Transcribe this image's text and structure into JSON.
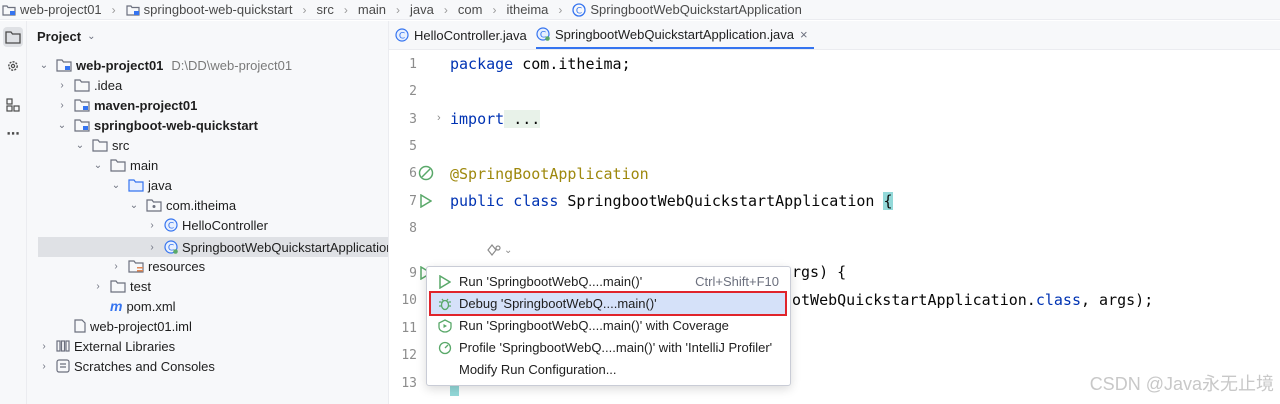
{
  "breadcrumb": [
    "web-project01",
    "springboot-web-quickstart",
    "src",
    "main",
    "java",
    "com",
    "itheima",
    "SpringbootWebQuickstartApplication"
  ],
  "project": {
    "title": "Project",
    "tree": [
      {
        "label": "web-project01",
        "path": "D:\\DD\\web-project01"
      },
      {
        "label": ".idea"
      },
      {
        "label": "maven-project01"
      },
      {
        "label": "springboot-web-quickstart"
      },
      {
        "label": "src"
      },
      {
        "label": "main"
      },
      {
        "label": "java"
      },
      {
        "label": "com.itheima"
      },
      {
        "label": "HelloController"
      },
      {
        "label": "SpringbootWebQuickstartApplication"
      },
      {
        "label": "resources"
      },
      {
        "label": "test"
      },
      {
        "label": "pom.xml"
      },
      {
        "label": "web-project01.iml"
      },
      {
        "label": "External Libraries"
      },
      {
        "label": "Scratches and Consoles"
      }
    ]
  },
  "tabs": [
    {
      "label": "HelloController.java"
    },
    {
      "label": "SpringbootWebQuickstartApplication.java",
      "close": "×"
    }
  ],
  "code": {
    "line_numbers": [
      "1",
      "2",
      "3",
      "5",
      "6",
      "7",
      "8",
      "9",
      "10",
      "11",
      "12",
      "13"
    ],
    "l1_kw": "package",
    "l1_rest": " com.itheima;",
    "l3_kw": "import",
    "l3_rest": " ...",
    "l6": "@SpringBootApplication",
    "l7_kw1": "public",
    "l7_kw2": "class",
    "l7_rest": " SpringbootWebQuickstartApplication ",
    "l7_brace": "{",
    "l9_tail": "rgs) {",
    "l10_a": "otWebQuickstartApplication.",
    "l10_b": "class",
    "l10_c": ", args);"
  },
  "popup": {
    "items": [
      {
        "label": "Run 'SpringbootWebQ....main()'",
        "shortcut": "Ctrl+Shift+F10"
      },
      {
        "label": "Debug 'SpringbootWebQ....main()'"
      },
      {
        "label": "Run 'SpringbootWebQ....main()' with Coverage"
      },
      {
        "label": "Profile 'SpringbootWebQ....main()' with 'IntelliJ Profiler'"
      },
      {
        "label": "Modify Run Configuration..."
      }
    ]
  },
  "watermark": "CSDN @Java永无止境",
  "colors": {
    "accent": "#3574f0",
    "selection": "#d5e1f9",
    "highlight_border": "#e0242b",
    "keyword": "#0033b3",
    "annotation": "#9e880d"
  }
}
